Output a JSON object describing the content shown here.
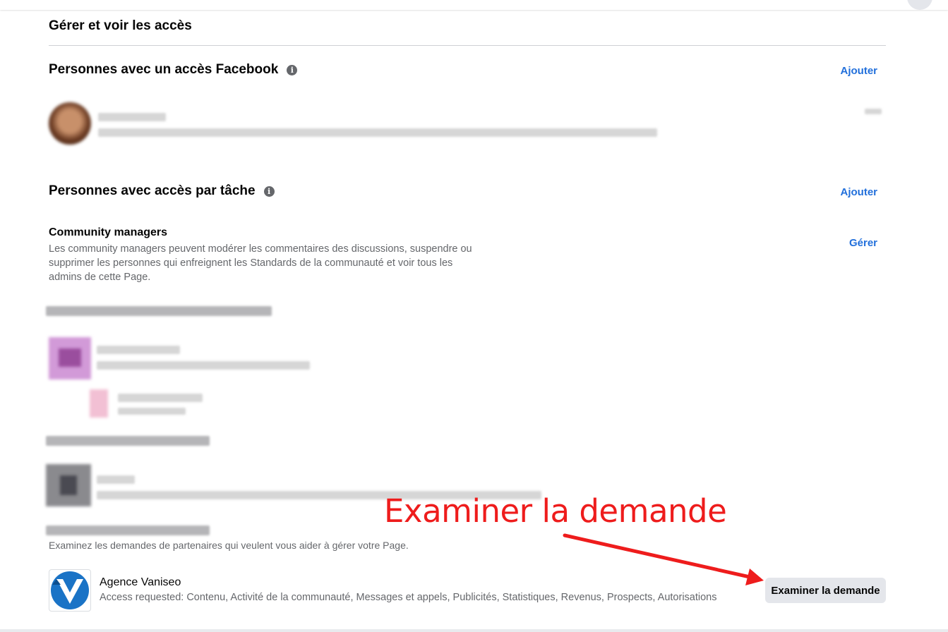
{
  "page": {
    "title": "Gérer et voir les accès"
  },
  "facebook_access": {
    "title": "Personnes avec un accès Facebook",
    "add_label": "Ajouter"
  },
  "task_access": {
    "title": "Personnes avec accès par tâche",
    "add_label": "Ajouter",
    "community_managers": {
      "title": "Community managers",
      "description": "Les community managers peuvent modérer les commentaires des discussions, suspendre ou supprimer les personnes qui enfreignent les Standards de la communauté et voir tous les admins de cette Page.",
      "manage_label": "Gérer"
    }
  },
  "partner_requests": {
    "description": "Examinez les demandes de partenaires qui veulent vous aider à gérer votre Page.",
    "request": {
      "name": "Agence Vaniseo",
      "access": "Access requested: Contenu, Activité de la communauté, Messages et appels, Publicités, Statistiques, Revenus, Prospects, Autorisations",
      "button_label": "Examiner la demande",
      "logo_icon": "vaniseo-logo-icon"
    }
  },
  "annotation": {
    "text": "Examiner la demande",
    "color": "#ee1c1c"
  },
  "colors": {
    "link": "#216fdb",
    "secondary_text": "#65676b",
    "button_bg": "#e4e6eb"
  }
}
